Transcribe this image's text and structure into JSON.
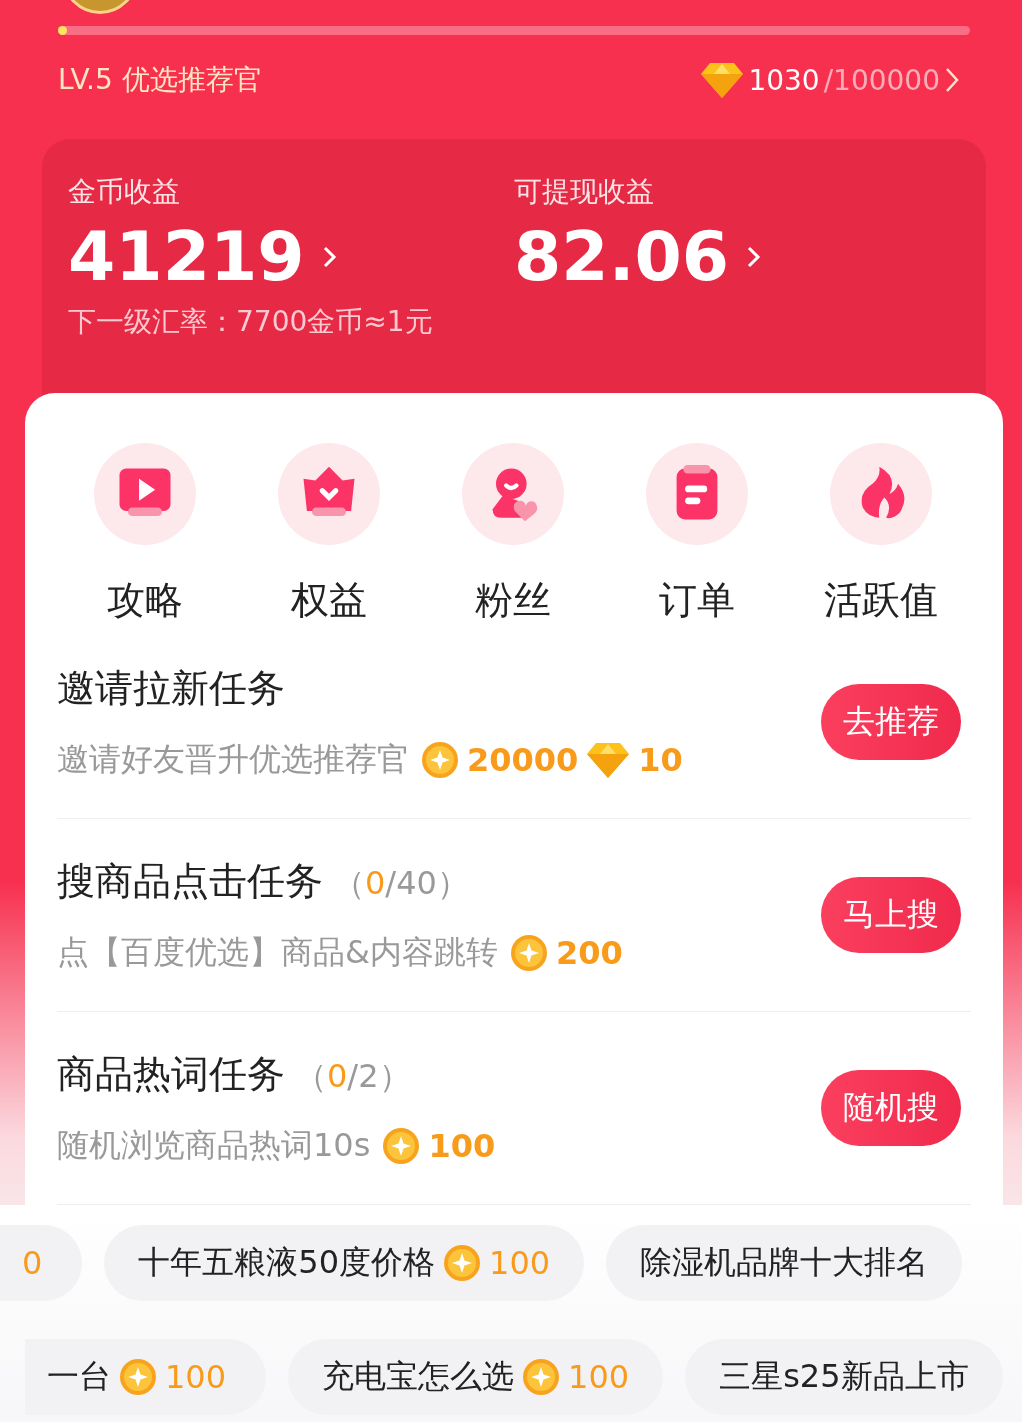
{
  "progress": {
    "level": 0.01
  },
  "rank": {
    "label": "LV.5 优选推荐官",
    "points": "1030",
    "total": "/100000"
  },
  "earnings": [
    {
      "label": "金币收益",
      "value": "41219"
    },
    {
      "label": "可提现收益",
      "value": "82.06"
    }
  ],
  "rate_note": "下一级汇率：7700金币≈1元",
  "shortcuts": [
    {
      "kind": "video",
      "label": "攻略"
    },
    {
      "kind": "crown",
      "label": "权益"
    },
    {
      "kind": "fans",
      "label": "粉丝"
    },
    {
      "kind": "order",
      "label": "订单"
    },
    {
      "kind": "fire",
      "label": "活跃值"
    }
  ],
  "tasks": [
    {
      "title": "邀请拉新任务",
      "desc": "邀请好友晋升优选推荐官",
      "rewards": [
        {
          "kind": "coin",
          "amount": "20000"
        },
        {
          "kind": "diamond",
          "amount": "10"
        }
      ],
      "button": "去推荐"
    },
    {
      "title": "搜商品点击任务",
      "progress": {
        "open": "（",
        "done": "0",
        "rest": "/40）"
      },
      "desc": "点【百度优选】商品&内容跳转",
      "rewards": [
        {
          "kind": "coin",
          "amount": "200"
        }
      ],
      "button": "马上搜"
    },
    {
      "title": "商品热词任务",
      "progress": {
        "open": "（",
        "done": "0",
        "rest": "/2）"
      },
      "desc": "随机浏览商品热词10s",
      "rewards": [
        {
          "kind": "coin",
          "amount": "100"
        }
      ],
      "button": "随机搜"
    }
  ],
  "keyword_rows": [
    [
      {
        "reward": "0"
      },
      {
        "name": "十年五粮液50度价格",
        "reward": "100"
      },
      {
        "name": "除湿机品牌十大排名"
      }
    ],
    [
      {
        "name": "一台",
        "reward": "100"
      },
      {
        "name": "充电宝怎么选",
        "reward": "100"
      },
      {
        "name": "三星s25新品上市"
      }
    ]
  ]
}
